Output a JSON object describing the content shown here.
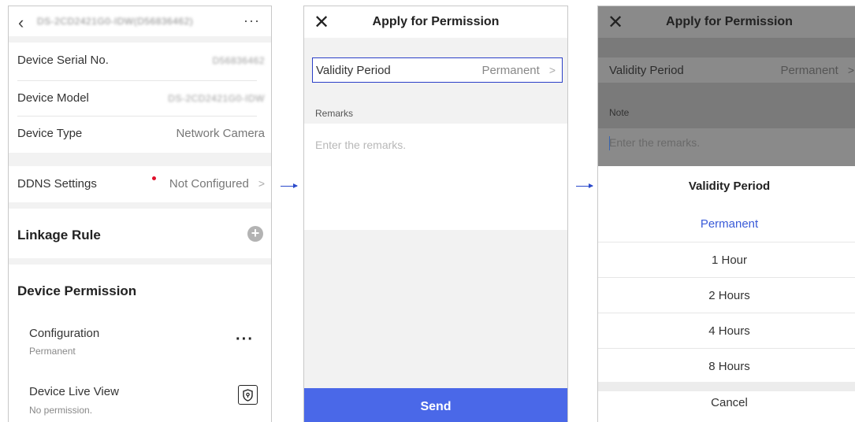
{
  "screen1": {
    "title_blurred": "DS-2CD2421G0-IDW(D56836462)",
    "rows": [
      {
        "label": "Device Serial No.",
        "value": "D56836462"
      },
      {
        "label": "Device Model",
        "value": "DS-2CD2421G0-IDW"
      },
      {
        "label": "Device Type",
        "value": "Network Camera"
      }
    ],
    "ddns": {
      "label": "DDNS Settings",
      "value": "Not Configured"
    },
    "linkage_rule": "Linkage Rule",
    "device_permission": "Device Permission",
    "permissions": [
      {
        "name": "Configuration",
        "status": "Permanent"
      },
      {
        "name": "Device Live View",
        "status": "No permission."
      }
    ]
  },
  "screen2": {
    "title": "Apply for Permission",
    "validity_label": "Validity Period",
    "validity_value": "Permanent",
    "remarks_label": "Remarks",
    "remarks_placeholder": "Enter the remarks.",
    "send_label": "Send"
  },
  "screen3": {
    "title": "Apply for Permission",
    "validity_label": "Validity Period",
    "validity_value": "Permanent",
    "note_label": "Note",
    "note_placeholder": "Enter the remarks.",
    "sheet_title": "Validity Period",
    "options": [
      "Permanent",
      "1 Hour",
      "2 Hours",
      "4 Hours",
      "8 Hours"
    ],
    "selected_option": "Permanent",
    "cancel_label": "Cancel"
  },
  "colors": {
    "accent": "#4a68e8",
    "selected": "#3a5bd8",
    "arrow": "#2b4acb",
    "alert_dot": "#e0102b"
  }
}
